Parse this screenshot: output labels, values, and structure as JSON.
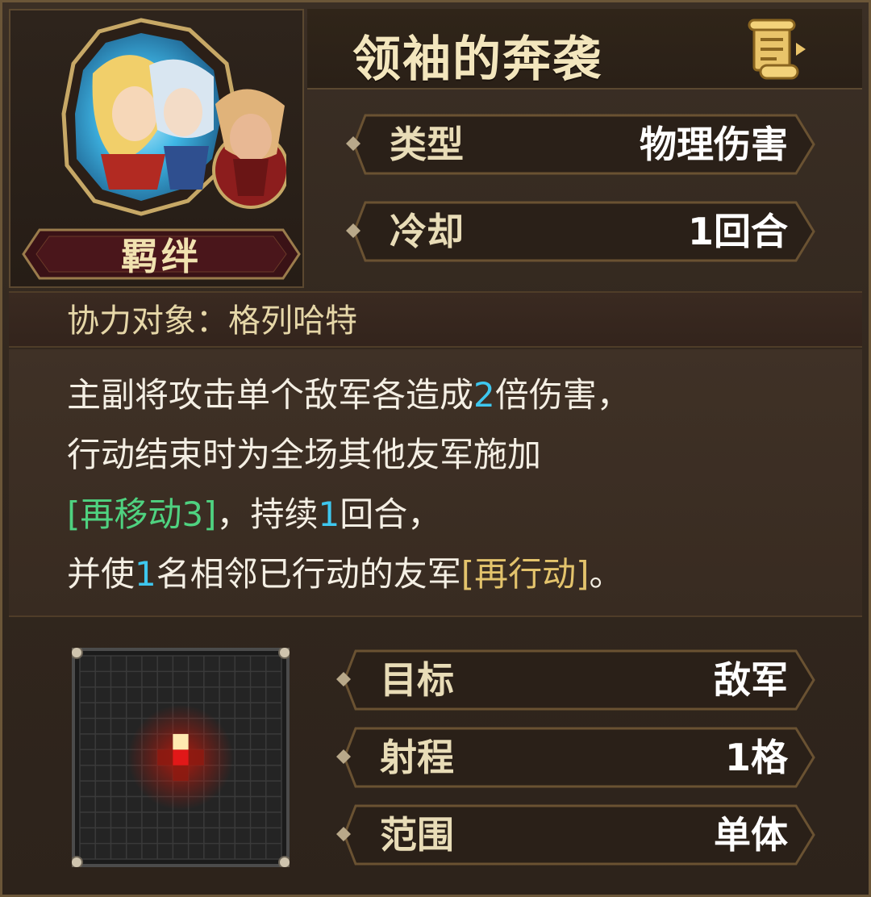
{
  "skill": {
    "title": "领袖的奔袭",
    "icon": "scroll-icon",
    "portrait_icon": "bond-portrait-icon",
    "bond_label": "羁绊"
  },
  "stats_top": [
    {
      "label": "类型",
      "value": "物理伤害"
    },
    {
      "label": "冷却",
      "value": "1回合"
    }
  ],
  "partner": {
    "text": "协力对象：格列哈特"
  },
  "description": {
    "line1": {
      "a": "主副将攻击单个敌军各造成",
      "b": "2",
      "c": "倍伤害，"
    },
    "line2": {
      "a": "行动结束时为全场其他友军施加"
    },
    "line3": {
      "a": "[再移动3]",
      "b": "，持续",
      "c": "1",
      "d": "回合，"
    },
    "line4": {
      "a": "并使",
      "b": "1",
      "c": "名相邻已行动的友军",
      "d": "[再行动]",
      "e": "。"
    }
  },
  "stats_bottom": [
    {
      "label": "目标",
      "value": "敌军"
    },
    {
      "label": "射程",
      "value": "1格"
    },
    {
      "label": "范围",
      "value": "单体"
    }
  ],
  "range_grid": {
    "cols": 13,
    "rows": 13,
    "center": [
      6,
      6
    ],
    "target": [
      6,
      5
    ],
    "colors": {
      "bg": "#242424",
      "line": "#3a3a3a",
      "center": "#e11818",
      "target": "#ffe9b0",
      "glow": "#b81a0d"
    }
  }
}
